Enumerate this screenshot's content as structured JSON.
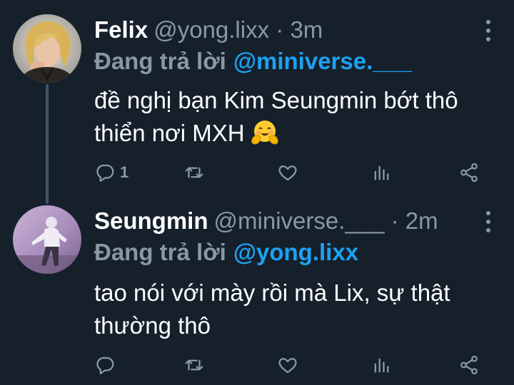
{
  "tweets": [
    {
      "display_name": "Felix",
      "handle": "@yong.lixx",
      "separator": "·",
      "time": "3m",
      "reply_prefix": "Đang trả lời",
      "reply_to": "@miniverse.___",
      "text": "đề nghị bạn Kim Seungmin bớt thô thiển nơi MXH",
      "emoji": "smiling-face-with-open-hands",
      "reply_count": "1"
    },
    {
      "display_name": "Seungmin",
      "handle": "@miniverse.___",
      "separator": "·",
      "time": "2m",
      "reply_prefix": "Đang trả lời",
      "reply_to": "@yong.lixx",
      "text": "tao nói với mày rồi mà Lix, sự thật thường thô",
      "reply_count": ""
    }
  ],
  "icons": {
    "reply": "reply-icon",
    "retweet": "retweet-icon",
    "like": "heart-icon",
    "stats": "stats-icon",
    "share": "share-icon",
    "more": "more-icon"
  },
  "colors": {
    "background": "#15202b",
    "primary_text": "#ffffff",
    "secondary_text": "#8899a6",
    "accent": "#1da1f2",
    "thread_line": "#3d5466"
  }
}
